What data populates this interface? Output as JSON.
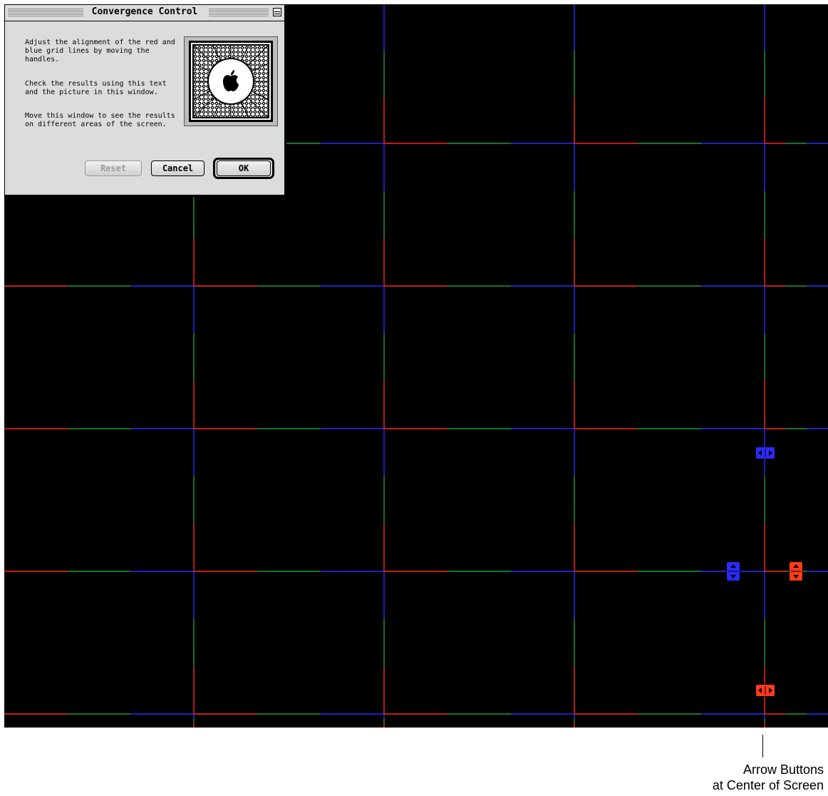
{
  "dialog": {
    "title": "Convergence Control",
    "paragraphs": [
      "Adjust the alignment of the red and blue grid lines by moving the handles.",
      "Check the results using this text and the picture in this window.",
      "Move this window to see the results on different areas of the screen."
    ],
    "buttons": {
      "reset": "Reset",
      "cancel": "Cancel",
      "ok": "OK"
    },
    "reset_enabled": false,
    "default_button": "ok"
  },
  "handles": [
    {
      "color": "blue",
      "direction": "horizontal"
    },
    {
      "color": "blue",
      "direction": "vertical"
    },
    {
      "color": "red",
      "direction": "vertical"
    },
    {
      "color": "red",
      "direction": "horizontal"
    }
  ],
  "colors": {
    "screen": "#000000",
    "red_line": "#ff2a1a",
    "green_line": "#1f9a3a",
    "blue_line": "#2a2aff",
    "blue_handle": "#2a2aff",
    "red_handle": "#ff3a1a",
    "dialog_bg": "#dcdcdc"
  },
  "icons": {
    "test_picture": "apple-logo-icon",
    "collapse": "window-collapse-icon"
  },
  "callout": {
    "line1": "Arrow Buttons",
    "line2": "at Center of Screen"
  }
}
